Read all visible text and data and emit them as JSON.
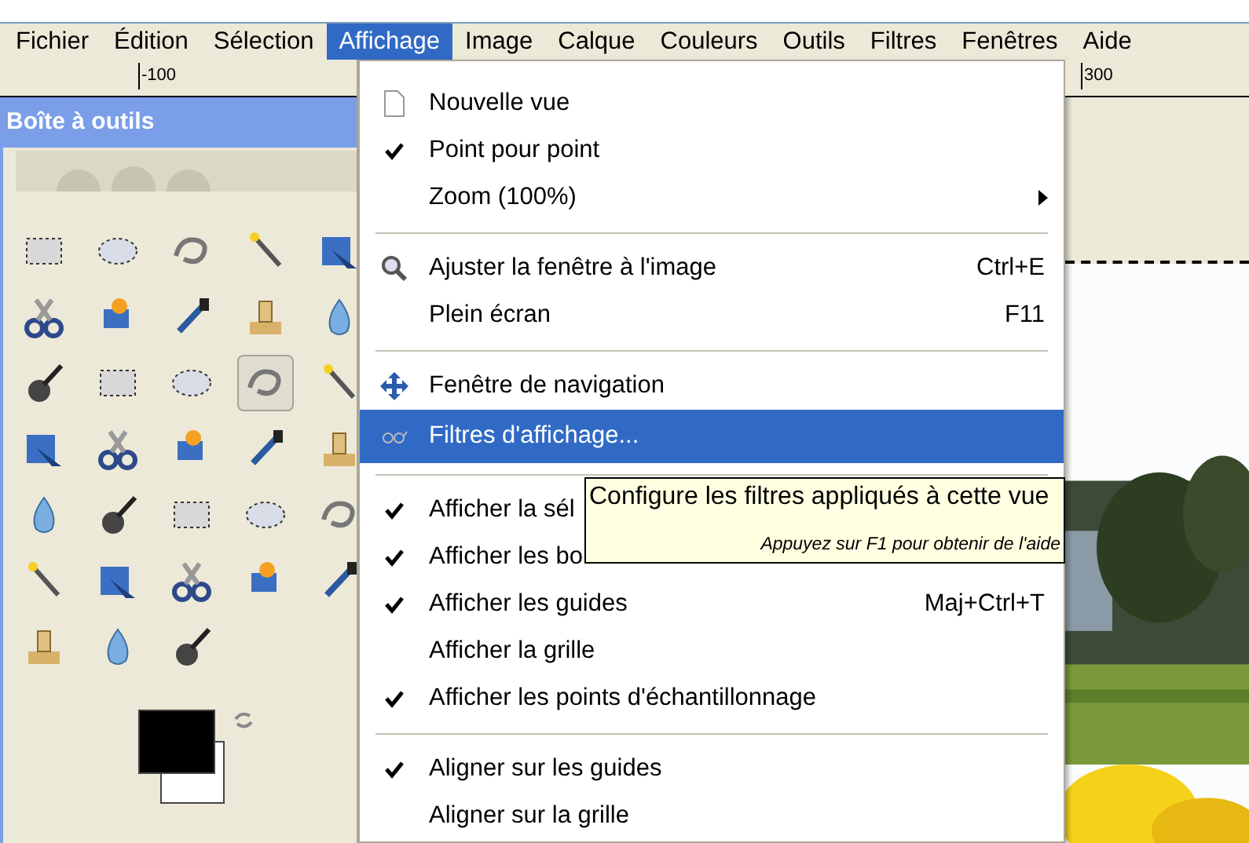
{
  "menubar": [
    {
      "label": "Fichier",
      "selected": false
    },
    {
      "label": "Édition",
      "selected": false
    },
    {
      "label": "Sélection",
      "selected": false
    },
    {
      "label": "Affichage",
      "selected": true
    },
    {
      "label": "Image",
      "selected": false
    },
    {
      "label": "Calque",
      "selected": false
    },
    {
      "label": "Couleurs",
      "selected": false
    },
    {
      "label": "Outils",
      "selected": false
    },
    {
      "label": "Filtres",
      "selected": false
    },
    {
      "label": "Fenêtres",
      "selected": false
    },
    {
      "label": "Aide",
      "selected": false
    }
  ],
  "ruler_left": {
    "label": "-100"
  },
  "ruler_right": {
    "label": "300"
  },
  "toolbox": {
    "title": "Boîte à outils",
    "tools": [
      {
        "selected": false
      },
      {
        "selected": false
      },
      {
        "selected": false
      },
      {
        "selected": false
      },
      {
        "selected": false
      },
      {
        "selected": false
      },
      {
        "selected": false
      },
      {
        "selected": false
      },
      {
        "selected": false
      },
      {
        "selected": false
      },
      {
        "selected": false
      },
      {
        "selected": false
      },
      {
        "selected": false
      },
      {
        "selected": true
      },
      {
        "selected": false
      },
      {
        "selected": false
      },
      {
        "selected": false
      },
      {
        "selected": false
      },
      {
        "selected": false
      },
      {
        "selected": false
      },
      {
        "selected": false
      },
      {
        "selected": false
      },
      {
        "selected": false
      },
      {
        "selected": false
      },
      {
        "selected": false
      },
      {
        "selected": false
      },
      {
        "selected": false
      },
      {
        "selected": false
      },
      {
        "selected": false
      },
      {
        "selected": false
      },
      {
        "selected": false
      },
      {
        "selected": false
      },
      {
        "selected": false
      }
    ]
  },
  "menu": [
    {
      "kind": "item",
      "label": "Nouvelle vue",
      "checked": false,
      "selected": false
    },
    {
      "kind": "item",
      "label": "Point pour point",
      "checked": true,
      "selected": false
    },
    {
      "kind": "submenu",
      "label": "Zoom (100%)",
      "checked": false,
      "selected": false
    },
    {
      "kind": "separator"
    },
    {
      "kind": "item",
      "label": "Ajuster la fenêtre à l'image",
      "shortcut": "Ctrl+E",
      "checked": false,
      "selected": false
    },
    {
      "kind": "item",
      "label": "Plein écran",
      "shortcut": "F11",
      "checked": false,
      "selected": false
    },
    {
      "kind": "separator"
    },
    {
      "kind": "item",
      "label": "Fenêtre de navigation",
      "checked": false,
      "selected": false
    },
    {
      "kind": "item",
      "label": "Filtres d'affichage...",
      "checked": false,
      "selected": true
    },
    {
      "kind": "separator"
    },
    {
      "kind": "item",
      "label": "Afficher la sél",
      "checked": true,
      "selected": false
    },
    {
      "kind": "item",
      "label": "Afficher les bo",
      "checked": true,
      "selected": false
    },
    {
      "kind": "item",
      "label": "Afficher les guides",
      "shortcut": "Maj+Ctrl+T",
      "checked": true,
      "selected": false
    },
    {
      "kind": "item",
      "label": "Afficher la grille",
      "checked": false,
      "selected": false
    },
    {
      "kind": "item",
      "label": "Afficher les points d'échantillonnage",
      "checked": true,
      "selected": false
    },
    {
      "kind": "separator"
    },
    {
      "kind": "item",
      "label": "Aligner sur les guides",
      "checked": true,
      "selected": false
    },
    {
      "kind": "item",
      "label": "Aligner sur la grille",
      "checked": false,
      "selected": false
    }
  ],
  "tooltip": {
    "text": "Configure les filtres appliqués à cette vue",
    "hint": "Appuyez sur F1 pour obtenir de l'aide"
  }
}
